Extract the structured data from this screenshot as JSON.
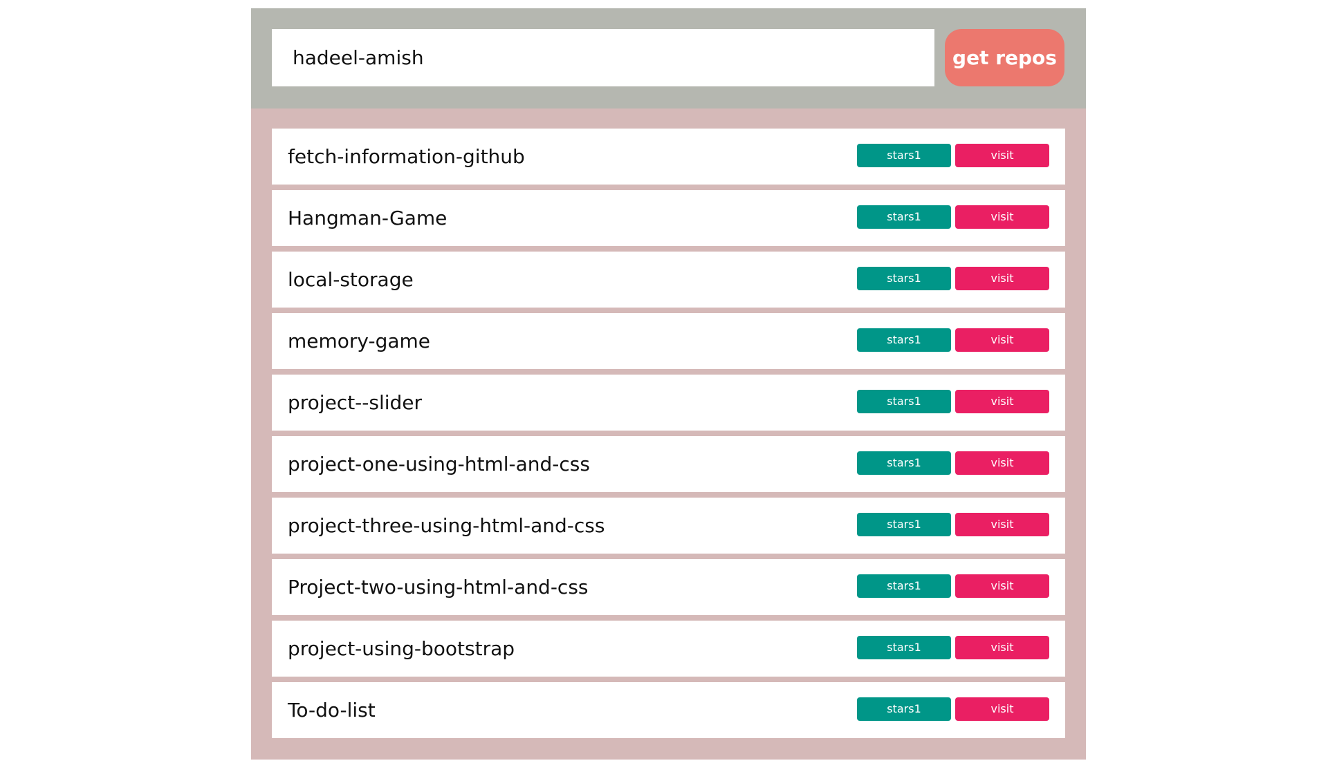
{
  "search": {
    "value": "hadeel-amish",
    "button_label": "get repos"
  },
  "colors": {
    "top_bar": "#b5b7b0",
    "list_background": "#d5b9b8",
    "button": "#ec786e",
    "stars_badge": "#009688",
    "visit_link": "#ea1f63"
  },
  "repos": [
    {
      "name": "fetch-information-github",
      "stars": "stars1",
      "visit": "visit"
    },
    {
      "name": "Hangman-Game",
      "stars": "stars1",
      "visit": "visit"
    },
    {
      "name": "local-storage",
      "stars": "stars1",
      "visit": "visit"
    },
    {
      "name": "memory-game",
      "stars": "stars1",
      "visit": "visit"
    },
    {
      "name": "project--slider",
      "stars": "stars1",
      "visit": "visit"
    },
    {
      "name": "project-one-using-html-and-css",
      "stars": "stars1",
      "visit": "visit"
    },
    {
      "name": "project-three-using-html-and-css",
      "stars": "stars1",
      "visit": "visit"
    },
    {
      "name": "Project-two-using-html-and-css",
      "stars": "stars1",
      "visit": "visit"
    },
    {
      "name": "project-using-bootstrap",
      "stars": "stars1",
      "visit": "visit"
    },
    {
      "name": "To-do-list",
      "stars": "stars1",
      "visit": "visit"
    }
  ]
}
